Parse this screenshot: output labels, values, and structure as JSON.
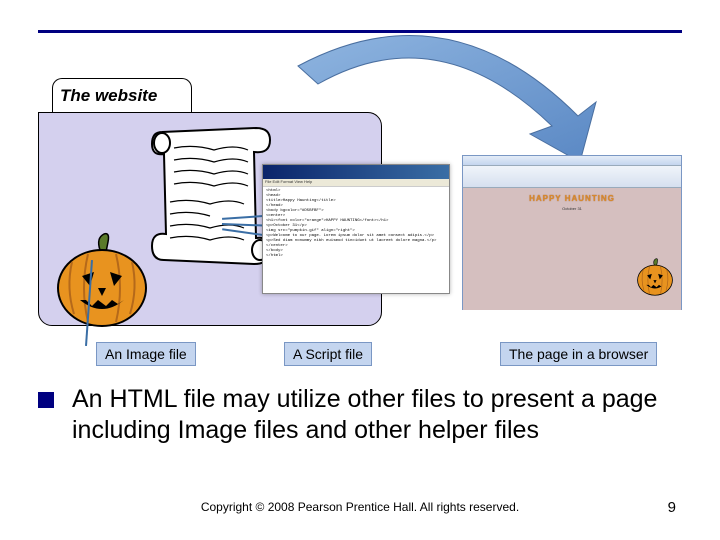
{
  "folder": {
    "title": "The website"
  },
  "labels": {
    "image": "An Image file",
    "script": "A Script file",
    "browser": "The page in a browser"
  },
  "bullet": "An HTML file may utilize other files to present a page including Image files and other helper files",
  "copyright": "Copyright © 2008 Pearson Prentice Hall. All rights reserved.",
  "page_number": "9",
  "browser_page": {
    "banner": "HAPPY HAUNTING",
    "sub": "October 31"
  },
  "notepad": {
    "menu": "File  Edit  Format  View  Help",
    "code": "<html>\n<head>\n<title>Happy Haunting</title>\n</head>\n<body bgcolor=\"#D5BFBF\">\n<center>\n<h1><font color=\"orange\">HAPPY HAUNTING</font></h1>\n<p>October 31</p>\n<img src=\"pumpkin.gif\" align=\"right\">\n<p>Welcome to our page. Lorem ipsum dolor sit amet consect adipis.</p>\n<p>Sed diam nonummy nibh euismod tincidunt ut laoreet dolore magna.</p>\n</center>\n</body>\n</html>"
  }
}
